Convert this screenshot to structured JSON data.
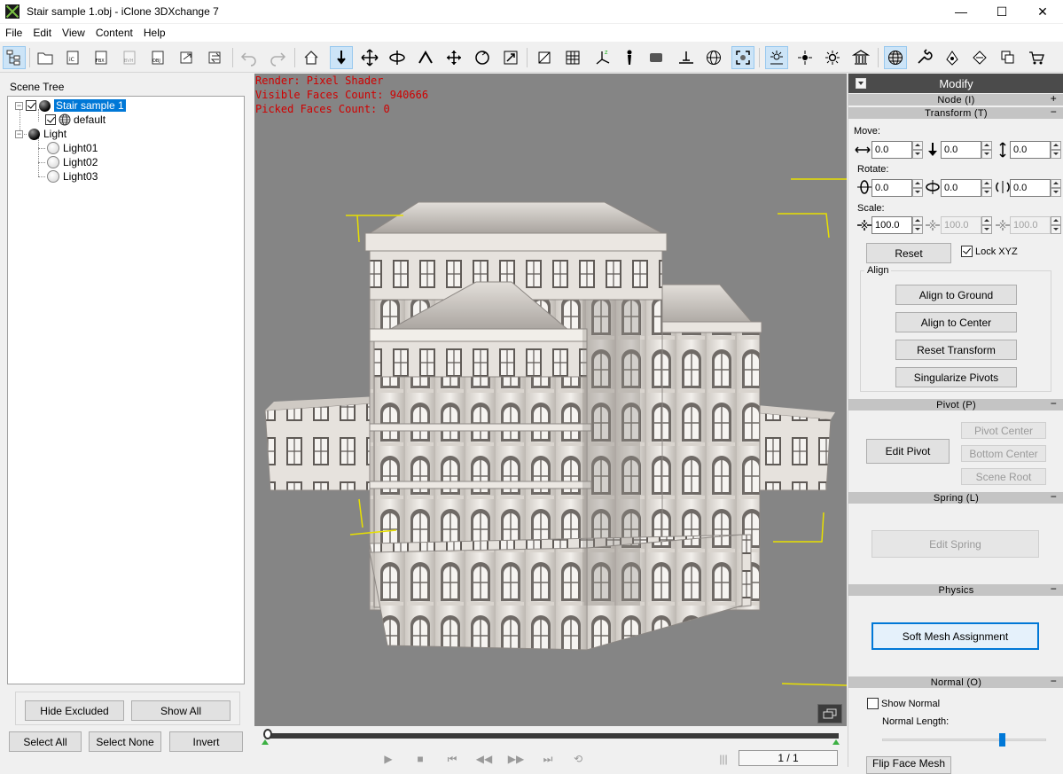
{
  "window": {
    "title": "Stair sample 1.obj - iClone 3DXchange 7",
    "min": "—",
    "max": "☐",
    "close": "✕"
  },
  "menu": [
    "File",
    "Edit",
    "View",
    "Content",
    "Help"
  ],
  "toolbar": {
    "icons": [
      "scene-tree",
      "open-folder",
      "import-ic",
      "import-fbx",
      "import-bvh",
      "import-obj",
      "export",
      "convert",
      "undo",
      "redo",
      "home",
      "drop",
      "move",
      "rotate",
      "pick",
      "pan",
      "orbit",
      "zoom",
      "toggle-box",
      "grid",
      "axis",
      "figure",
      "plane",
      "ground",
      "globe",
      "frame",
      "light-a",
      "light-b",
      "light-c",
      "museum",
      "sphere-grid",
      "wrench",
      "hand-box",
      "hand-cube",
      "stack",
      "cart"
    ]
  },
  "scene_tree": {
    "title": "Scene Tree",
    "nodes": [
      {
        "label": "Stair sample 1",
        "selected": true
      },
      {
        "label": "default"
      },
      {
        "label": "Light"
      },
      {
        "label": "Light01"
      },
      {
        "label": "Light02"
      },
      {
        "label": "Light03"
      }
    ],
    "hide_excluded": "Hide Excluded",
    "show_all": "Show All",
    "select_all": "Select All",
    "select_none": "Select None",
    "invert": "Invert"
  },
  "viewport": {
    "render": "Render: Pixel Shader",
    "visible_faces": "Visible Faces Count: 940666",
    "picked_faces": "Picked Faces Count: 0"
  },
  "timeline": {
    "frame": "1 / 1",
    "position": 0
  },
  "modify": {
    "header": "Modify",
    "node": "Node (I)",
    "transform": "Transform (T)",
    "move_label": "Move:",
    "move": [
      "0.0",
      "0.0",
      "0.0"
    ],
    "rotate_label": "Rotate:",
    "rotate": [
      "0.0",
      "0.0",
      "0.0"
    ],
    "scale_label": "Scale:",
    "scale": [
      "100.0",
      "100.0",
      "100.0"
    ],
    "reset": "Reset",
    "lock_xyz": "Lock XYZ",
    "align_title": "Align",
    "align_ground": "Align to Ground",
    "align_center": "Align to Center",
    "reset_transform": "Reset Transform",
    "singularize": "Singularize Pivots",
    "pivot": "Pivot (P)",
    "edit_pivot": "Edit Pivot",
    "pivot_center": "Pivot Center",
    "bottom_center": "Bottom Center",
    "scene_root": "Scene Root",
    "spring": "Spring (L)",
    "edit_spring": "Edit Spring",
    "physics": "Physics",
    "soft_mesh": "Soft Mesh Assignment",
    "normal": "Normal (O)",
    "show_normal": "Show Normal",
    "normal_length": "Normal Length:",
    "normal_length_value": 0.73,
    "flip_label": "Flip Face Mesh"
  },
  "colors": {
    "selection": "#0078d7",
    "viewport": "#858585",
    "info_text": "#d00000",
    "gizmo": "#e8e000"
  }
}
